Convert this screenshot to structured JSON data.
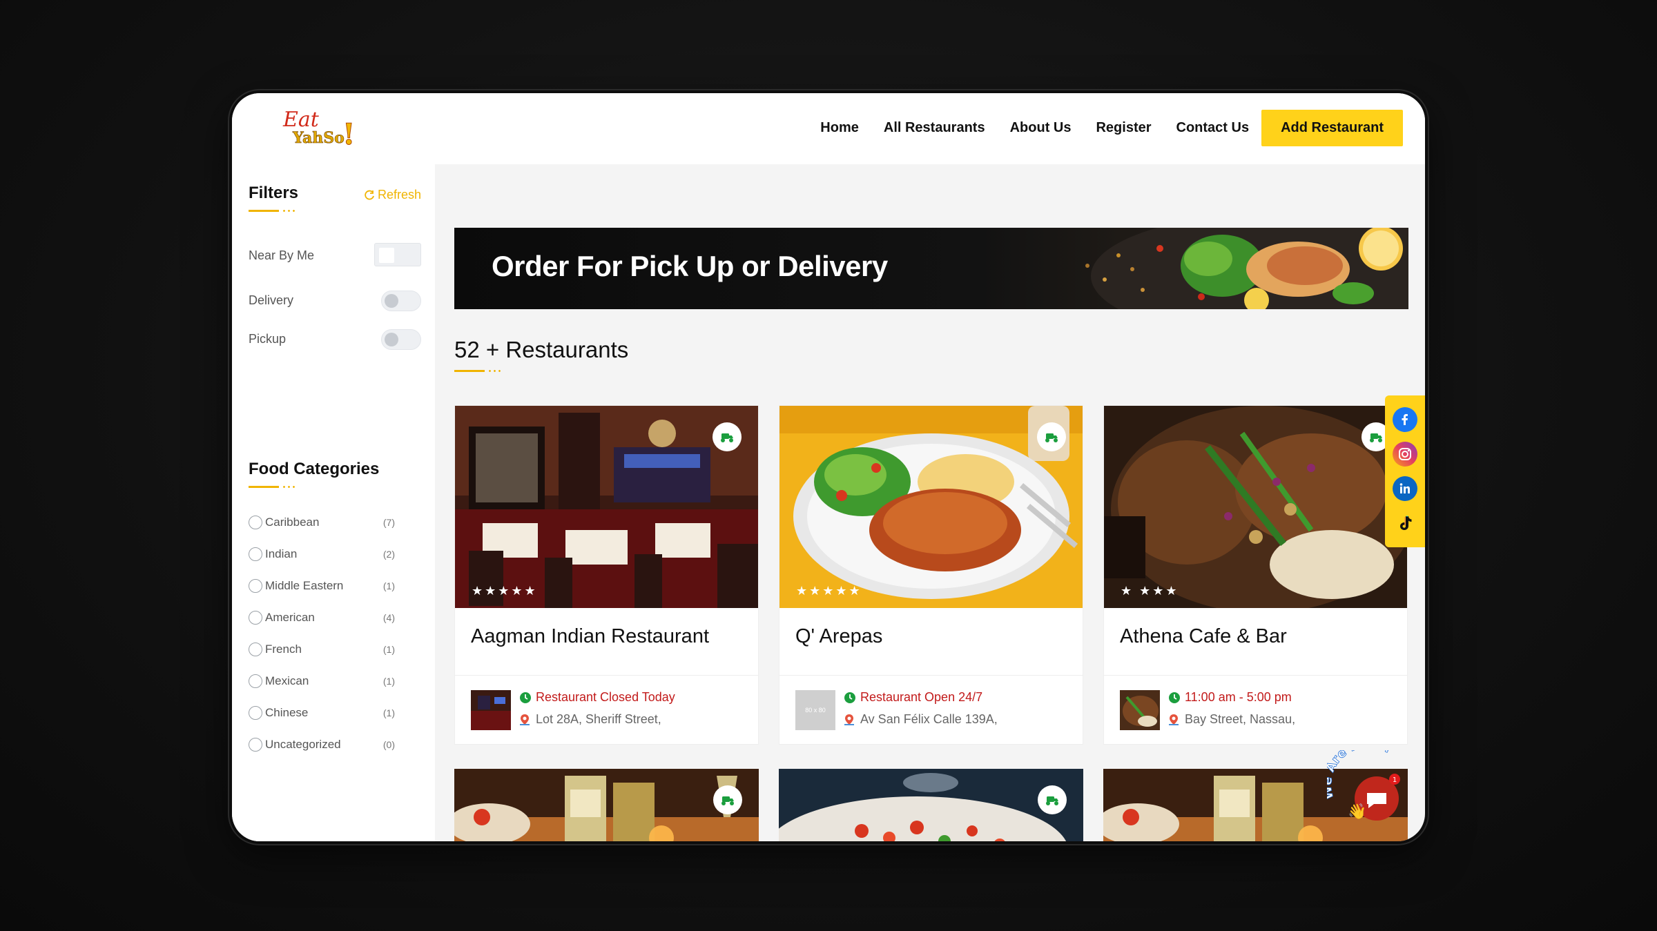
{
  "logo": {
    "line1": "Eat",
    "line2": "YahSo",
    "mark": "!"
  },
  "nav": {
    "items": [
      "Home",
      "All Restaurants",
      "About Us",
      "Register",
      "Contact Us"
    ],
    "cta": "Add Restaurant"
  },
  "filters": {
    "title": "Filters",
    "refresh": "Refresh",
    "near_by_me": "Near By Me",
    "delivery": "Delivery",
    "pickup": "Pickup"
  },
  "food_categories": {
    "title": "Food Categories",
    "items": [
      {
        "label": "Caribbean",
        "count": "(7)"
      },
      {
        "label": "Indian",
        "count": "(2)"
      },
      {
        "label": "Middle Eastern",
        "count": "(1)"
      },
      {
        "label": "American",
        "count": "(4)"
      },
      {
        "label": "French",
        "count": "(1)"
      },
      {
        "label": "Mexican",
        "count": "(1)"
      },
      {
        "label": "Chinese",
        "count": "(1)"
      },
      {
        "label": "Uncategorized",
        "count": "(0)"
      }
    ]
  },
  "banner": {
    "text": "Order For Pick Up or Delivery"
  },
  "restaurants_heading": "52 + Restaurants",
  "restaurants": [
    {
      "name": "Aagman Indian Restaurant",
      "status": "Restaurant Closed Today",
      "address": "Lot 28A, Sheriff Street,",
      "rating": 5
    },
    {
      "name": "Q' Arepas",
      "status": "Restaurant Open 24/7",
      "address": "Av San Félix Calle 139A,",
      "rating": 5,
      "thumb_text": "80 x 80"
    },
    {
      "name": "Athena Cafe & Bar",
      "status": "11:00 am - 5:00 pm",
      "address": "Bay Street, Nassau,",
      "rating": 4
    }
  ],
  "chat": {
    "badge": "1",
    "label": "We Are Here!"
  },
  "social": [
    "facebook-icon",
    "instagram-icon",
    "linkedin-icon",
    "tiktok-icon"
  ],
  "colors": {
    "accent": "#ffd21a",
    "accent_text": "#f0b400",
    "status_red": "#c21a1a",
    "clock_green": "#1b9e3e"
  }
}
